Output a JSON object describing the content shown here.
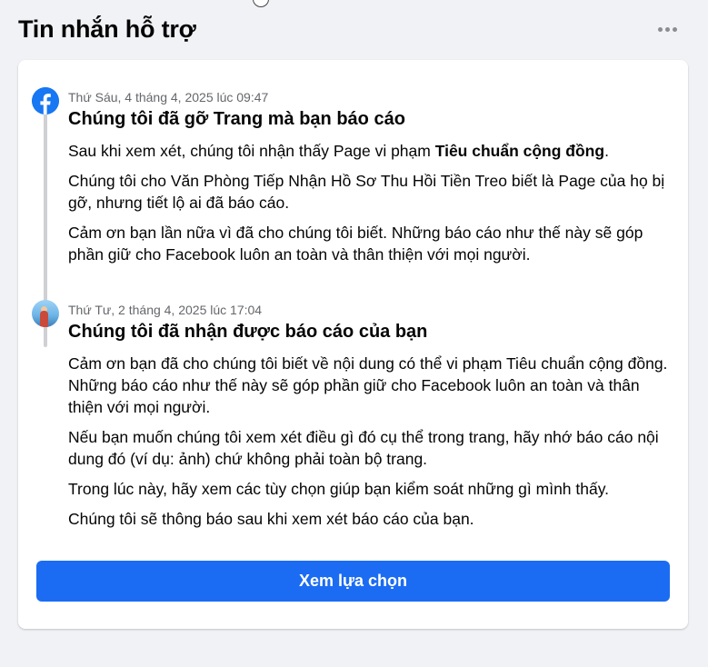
{
  "header": {
    "title": "Tin nhắn hỗ trợ"
  },
  "messages": [
    {
      "sender_icon": "facebook-logo-icon",
      "timestamp": "Thứ Sáu, 4 tháng 4, 2025 lúc 09:47",
      "title": "Chúng tôi đã gỡ Trang mà bạn báo cáo",
      "p1_prefix": "Sau khi xem xét, chúng tôi nhận thấy Page vi phạm ",
      "p1_bold": "Tiêu chuẩn cộng đồng",
      "p1_suffix": ".",
      "p2": "Chúng tôi cho Văn Phòng Tiếp Nhận Hồ Sơ Thu Hồi Tiền Treo biết là Page của họ bị gỡ, nhưng tiết lộ ai đã báo cáo.",
      "p3": "Cảm ơn bạn lần nữa vì đã cho chúng tôi biết. Những báo cáo như thế này sẽ góp phần giữ cho Facebook luôn an toàn và thân thiện với mọi người."
    },
    {
      "sender_icon": "user-avatar",
      "timestamp": "Thứ Tư, 2 tháng 4, 2025 lúc 17:04",
      "title": "Chúng tôi đã nhận được báo cáo của bạn",
      "p1": "Cảm ơn bạn đã cho chúng tôi biết về nội dung có thể vi phạm Tiêu chuẩn cộng đồng. Những báo cáo như thế này sẽ góp phần giữ cho Facebook luôn an toàn và thân thiện với mọi người.",
      "p2": "Nếu bạn muốn chúng tôi xem xét điều gì đó cụ thể trong trang, hãy nhớ báo cáo nội dung đó (ví dụ: ảnh) chứ không phải toàn bộ trang.",
      "p3": "Trong lúc này, hãy xem các tùy chọn giúp bạn kiểm soát những gì mình thấy.",
      "p4": "Chúng tôi sẽ thông báo sau khi xem xét báo cáo của bạn."
    }
  ],
  "actions": {
    "view_options_label": "Xem lựa chọn"
  },
  "colors": {
    "accent": "#1b6cf2",
    "facebook_blue": "#1877f2",
    "background": "#f0f2f5",
    "secondary_text": "#65676b"
  }
}
